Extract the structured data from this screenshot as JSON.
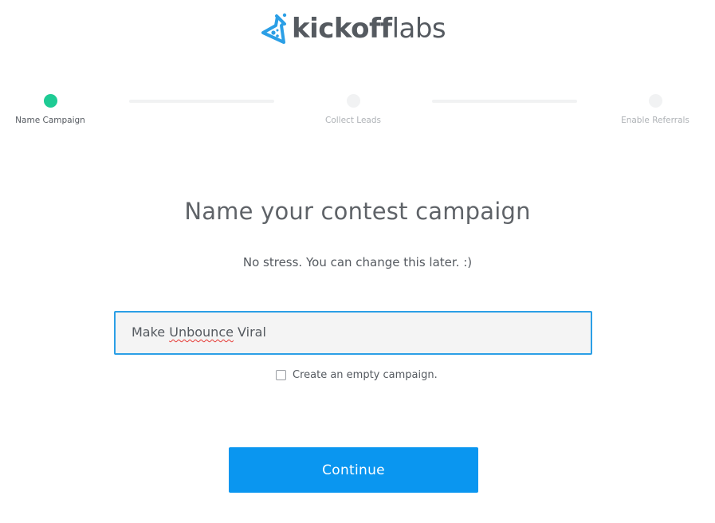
{
  "logo": {
    "text_bold": "kickoff",
    "text_light": "labs",
    "icon": "flask-icon",
    "colors": {
      "icon": "#2b9fe6",
      "text": "#555a60"
    }
  },
  "stepper": {
    "steps": [
      {
        "label": "Name Campaign",
        "active": true
      },
      {
        "label": "Collect Leads",
        "active": false
      },
      {
        "label": "Enable Referrals",
        "active": false
      }
    ],
    "colors": {
      "active": "#1ecb94",
      "inactive": "#f1f2f3"
    }
  },
  "main": {
    "title": "Name your contest campaign",
    "subtitle": "No stress. You can change this later. :)",
    "campaign_name": {
      "prefix": "Make ",
      "misspelled": "Unbounce",
      "suffix": " Viral"
    },
    "empty_campaign_label": "Create an empty campaign.",
    "empty_campaign_checked": false,
    "continue_label": "Continue"
  },
  "colors": {
    "accent": "#0a96f0",
    "focus_border": "#2b9fe6"
  }
}
